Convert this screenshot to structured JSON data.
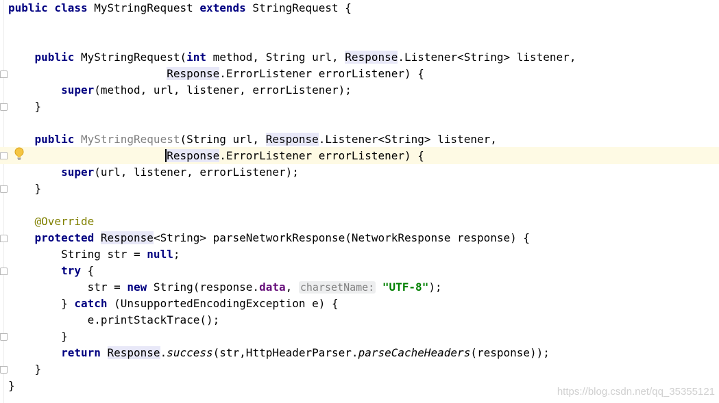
{
  "code": {
    "l1": {
      "kw1": "public class",
      "name": " MyStringRequest ",
      "kw2": "extends",
      "rest": " StringRequest {"
    },
    "l2": {
      "indent": "    ",
      "kw1": "public",
      "name": " MyStringRequest(",
      "kw2": "int",
      "t1": " method, String url, ",
      "ref": "Response",
      "t2": ".Listener<String> listener,"
    },
    "l3": {
      "indent": "                        ",
      "ref": "Response",
      "t": ".ErrorListener errorListener) {"
    },
    "l4": {
      "indent": "        ",
      "kw": "super",
      "t": "(method, url, listener, errorListener);"
    },
    "l5": {
      "t": "    }"
    },
    "l6": {
      "indent": "    ",
      "kw": "public",
      "space": " ",
      "name": "MyStringRequest",
      "t1": "(String url, ",
      "ref": "Response",
      "t2": ".Listener<String> listener,"
    },
    "l7": {
      "indent": "                        ",
      "ref_first": "R",
      "ref_rest": "esponse",
      "t": ".ErrorListener errorListener) {"
    },
    "l8": {
      "indent": "        ",
      "kw": "super",
      "t": "(url, listener, errorListener);"
    },
    "l9": {
      "t": "    }"
    },
    "l10": {
      "indent": "    ",
      "ann": "@Override"
    },
    "l11": {
      "indent": "    ",
      "kw": "protected",
      "space": " ",
      "ref": "Response",
      "t": "<String> parseNetworkResponse(NetworkResponse response) {"
    },
    "l12": {
      "indent": "        ",
      "t": "String str = ",
      "kw": "null",
      "end": ";"
    },
    "l13": {
      "indent": "        ",
      "kw": "try",
      "t": " {"
    },
    "l14": {
      "indent": "            ",
      "t1": "str = ",
      "kw": "new",
      "t2": " String(response.",
      "field": "data",
      "comma": ",",
      "hint": "charsetName:",
      "str": "\"UTF-8\"",
      "end": ");"
    },
    "l15": {
      "indent": "        ",
      "t1": "} ",
      "kw": "catch",
      "t2": " (UnsupportedEncodingException e) {"
    },
    "l16": {
      "indent": "            ",
      "t": "e.printStackTrace();"
    },
    "l17": {
      "t": "        }"
    },
    "l18": {
      "indent": "        ",
      "kw": "return",
      "space": " ",
      "ref": "Response",
      "dot": ".",
      "m1": "success",
      "t1": "(str,HttpHeaderParser.",
      "m2": "parseCacheHeaders",
      "t2": "(response));"
    },
    "l19": {
      "t": "    }"
    },
    "l20": {
      "t": "}"
    }
  },
  "watermark": "https://blog.csdn.net/qq_35355121",
  "colors": {
    "keyword": "#000080",
    "annotation": "#808000",
    "string": "#008000",
    "field": "#660e7a",
    "current_line": "#fefae4",
    "reference_highlight": "#e8e8f8"
  },
  "icons": {
    "intention": "lightbulb-icon",
    "fold": "fold-marker-icon"
  }
}
